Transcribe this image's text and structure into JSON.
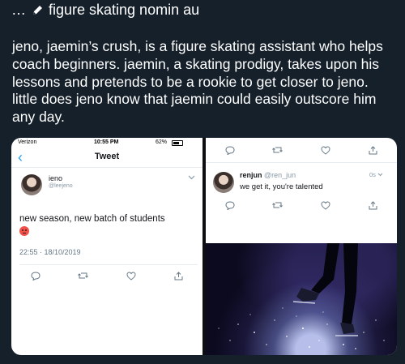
{
  "header": {
    "title": "figure skating nomin au"
  },
  "post": {
    "body": "jeno, jaemin’s crush, is a figure skating assistant who helps coach beginners. jaemin, a skating prodigy, takes upon his lessons and pretends to be a rookie to get closer to jeno. little does jeno know that jaemin could easily outscore him any day."
  },
  "left_screenshot": {
    "status": {
      "carrier": "Verizon",
      "time": "10:55 PM",
      "battery": "62%"
    },
    "nav_title": "Tweet",
    "tweet": {
      "author_name": "ieno",
      "author_handle": "@leejeno",
      "text": "new season, new batch of students",
      "timestamp": "22:55 · 18/10/2019"
    }
  },
  "right_screenshot": {
    "reply": {
      "author_name": "renjun",
      "author_handle": "@ren_jun",
      "time": "0s",
      "text": "we get it, you're talented"
    }
  },
  "icons": [
    "pencil-icon",
    "back-arrow-icon",
    "chevron-down-icon",
    "reply-icon",
    "retweet-icon",
    "like-icon",
    "share-icon",
    "angry-face-emoji"
  ],
  "colors": {
    "background": "#15202b",
    "accent": "#1da1f2",
    "text": "#ffffff"
  }
}
